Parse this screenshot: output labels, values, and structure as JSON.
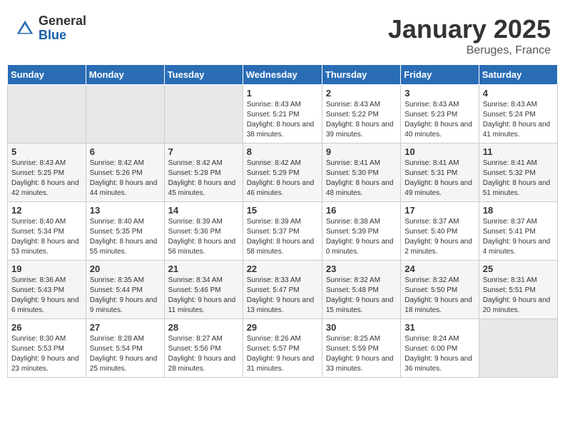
{
  "header": {
    "logo_general": "General",
    "logo_blue": "Blue",
    "month_title": "January 2025",
    "location": "Beruges, France"
  },
  "days_of_week": [
    "Sunday",
    "Monday",
    "Tuesday",
    "Wednesday",
    "Thursday",
    "Friday",
    "Saturday"
  ],
  "weeks": [
    [
      {
        "day": "",
        "sunrise": "",
        "sunset": "",
        "daylight": ""
      },
      {
        "day": "",
        "sunrise": "",
        "sunset": "",
        "daylight": ""
      },
      {
        "day": "",
        "sunrise": "",
        "sunset": "",
        "daylight": ""
      },
      {
        "day": "1",
        "sunrise": "Sunrise: 8:43 AM",
        "sunset": "Sunset: 5:21 PM",
        "daylight": "Daylight: 8 hours and 38 minutes."
      },
      {
        "day": "2",
        "sunrise": "Sunrise: 8:43 AM",
        "sunset": "Sunset: 5:22 PM",
        "daylight": "Daylight: 8 hours and 39 minutes."
      },
      {
        "day": "3",
        "sunrise": "Sunrise: 8:43 AM",
        "sunset": "Sunset: 5:23 PM",
        "daylight": "Daylight: 8 hours and 40 minutes."
      },
      {
        "day": "4",
        "sunrise": "Sunrise: 8:43 AM",
        "sunset": "Sunset: 5:24 PM",
        "daylight": "Daylight: 8 hours and 41 minutes."
      }
    ],
    [
      {
        "day": "5",
        "sunrise": "Sunrise: 8:43 AM",
        "sunset": "Sunset: 5:25 PM",
        "daylight": "Daylight: 8 hours and 42 minutes."
      },
      {
        "day": "6",
        "sunrise": "Sunrise: 8:42 AM",
        "sunset": "Sunset: 5:26 PM",
        "daylight": "Daylight: 8 hours and 44 minutes."
      },
      {
        "day": "7",
        "sunrise": "Sunrise: 8:42 AM",
        "sunset": "Sunset: 5:28 PM",
        "daylight": "Daylight: 8 hours and 45 minutes."
      },
      {
        "day": "8",
        "sunrise": "Sunrise: 8:42 AM",
        "sunset": "Sunset: 5:29 PM",
        "daylight": "Daylight: 8 hours and 46 minutes."
      },
      {
        "day": "9",
        "sunrise": "Sunrise: 8:41 AM",
        "sunset": "Sunset: 5:30 PM",
        "daylight": "Daylight: 8 hours and 48 minutes."
      },
      {
        "day": "10",
        "sunrise": "Sunrise: 8:41 AM",
        "sunset": "Sunset: 5:31 PM",
        "daylight": "Daylight: 8 hours and 49 minutes."
      },
      {
        "day": "11",
        "sunrise": "Sunrise: 8:41 AM",
        "sunset": "Sunset: 5:32 PM",
        "daylight": "Daylight: 8 hours and 51 minutes."
      }
    ],
    [
      {
        "day": "12",
        "sunrise": "Sunrise: 8:40 AM",
        "sunset": "Sunset: 5:34 PM",
        "daylight": "Daylight: 8 hours and 53 minutes."
      },
      {
        "day": "13",
        "sunrise": "Sunrise: 8:40 AM",
        "sunset": "Sunset: 5:35 PM",
        "daylight": "Daylight: 8 hours and 55 minutes."
      },
      {
        "day": "14",
        "sunrise": "Sunrise: 8:39 AM",
        "sunset": "Sunset: 5:36 PM",
        "daylight": "Daylight: 8 hours and 56 minutes."
      },
      {
        "day": "15",
        "sunrise": "Sunrise: 8:39 AM",
        "sunset": "Sunset: 5:37 PM",
        "daylight": "Daylight: 8 hours and 58 minutes."
      },
      {
        "day": "16",
        "sunrise": "Sunrise: 8:38 AM",
        "sunset": "Sunset: 5:39 PM",
        "daylight": "Daylight: 9 hours and 0 minutes."
      },
      {
        "day": "17",
        "sunrise": "Sunrise: 8:37 AM",
        "sunset": "Sunset: 5:40 PM",
        "daylight": "Daylight: 9 hours and 2 minutes."
      },
      {
        "day": "18",
        "sunrise": "Sunrise: 8:37 AM",
        "sunset": "Sunset: 5:41 PM",
        "daylight": "Daylight: 9 hours and 4 minutes."
      }
    ],
    [
      {
        "day": "19",
        "sunrise": "Sunrise: 8:36 AM",
        "sunset": "Sunset: 5:43 PM",
        "daylight": "Daylight: 9 hours and 6 minutes."
      },
      {
        "day": "20",
        "sunrise": "Sunrise: 8:35 AM",
        "sunset": "Sunset: 5:44 PM",
        "daylight": "Daylight: 9 hours and 9 minutes."
      },
      {
        "day": "21",
        "sunrise": "Sunrise: 8:34 AM",
        "sunset": "Sunset: 5:46 PM",
        "daylight": "Daylight: 9 hours and 11 minutes."
      },
      {
        "day": "22",
        "sunrise": "Sunrise: 8:33 AM",
        "sunset": "Sunset: 5:47 PM",
        "daylight": "Daylight: 9 hours and 13 minutes."
      },
      {
        "day": "23",
        "sunrise": "Sunrise: 8:32 AM",
        "sunset": "Sunset: 5:48 PM",
        "daylight": "Daylight: 9 hours and 15 minutes."
      },
      {
        "day": "24",
        "sunrise": "Sunrise: 8:32 AM",
        "sunset": "Sunset: 5:50 PM",
        "daylight": "Daylight: 9 hours and 18 minutes."
      },
      {
        "day": "25",
        "sunrise": "Sunrise: 8:31 AM",
        "sunset": "Sunset: 5:51 PM",
        "daylight": "Daylight: 9 hours and 20 minutes."
      }
    ],
    [
      {
        "day": "26",
        "sunrise": "Sunrise: 8:30 AM",
        "sunset": "Sunset: 5:53 PM",
        "daylight": "Daylight: 9 hours and 23 minutes."
      },
      {
        "day": "27",
        "sunrise": "Sunrise: 8:28 AM",
        "sunset": "Sunset: 5:54 PM",
        "daylight": "Daylight: 9 hours and 25 minutes."
      },
      {
        "day": "28",
        "sunrise": "Sunrise: 8:27 AM",
        "sunset": "Sunset: 5:56 PM",
        "daylight": "Daylight: 9 hours and 28 minutes."
      },
      {
        "day": "29",
        "sunrise": "Sunrise: 8:26 AM",
        "sunset": "Sunset: 5:57 PM",
        "daylight": "Daylight: 9 hours and 31 minutes."
      },
      {
        "day": "30",
        "sunrise": "Sunrise: 8:25 AM",
        "sunset": "Sunset: 5:59 PM",
        "daylight": "Daylight: 9 hours and 33 minutes."
      },
      {
        "day": "31",
        "sunrise": "Sunrise: 8:24 AM",
        "sunset": "Sunset: 6:00 PM",
        "daylight": "Daylight: 9 hours and 36 minutes."
      },
      {
        "day": "",
        "sunrise": "",
        "sunset": "",
        "daylight": ""
      }
    ]
  ]
}
